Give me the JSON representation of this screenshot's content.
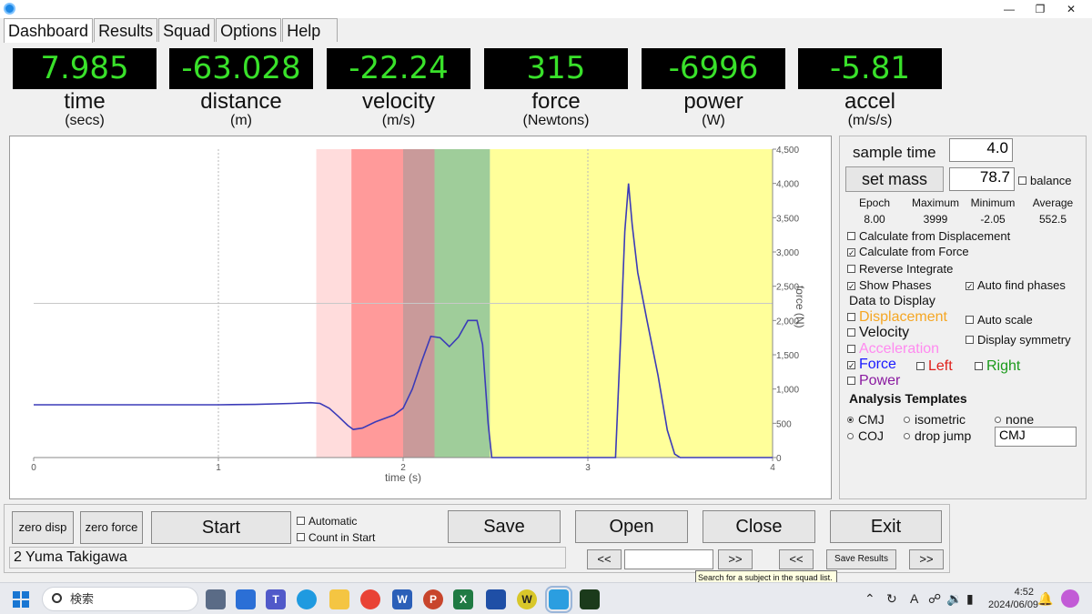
{
  "tabs": [
    {
      "label": "Dashboard",
      "active": true
    },
    {
      "label": "Results",
      "active": false
    },
    {
      "label": "Squad",
      "active": false
    },
    {
      "label": "Options",
      "active": false
    },
    {
      "label": "Help",
      "active": false
    }
  ],
  "metrics": [
    {
      "value": "7.985",
      "name": "time",
      "unit": "(secs)"
    },
    {
      "value": "-63.028",
      "name": "distance",
      "unit": "(m)"
    },
    {
      "value": "-22.24",
      "name": "velocity",
      "unit": "(m/s)"
    },
    {
      "value": "315",
      "name": "force",
      "unit": "(Newtons)"
    },
    {
      "value": "-6996",
      "name": "power",
      "unit": "(W)"
    },
    {
      "value": "-5.81",
      "name": "accel",
      "unit": "(m/s/s)"
    }
  ],
  "colors": {
    "lcd_text": "#39e12a",
    "force_line": "#3b3bb8",
    "phase_pink": "#ffdcdc",
    "phase_red": "#ff9a9a",
    "phase_brown": "#c99a9a",
    "phase_green": "#9fcd9a",
    "phase_yellow": "#ffff9a",
    "displacement": "#f5a623",
    "acceleration": "#ff8af0",
    "force_label": "#1a1aff",
    "left_label": "#e0201a",
    "right_label": "#1a9a1a",
    "power_label": "#8a1aa0"
  },
  "chart": {
    "x_ticks": [
      "0",
      "1",
      "2",
      "3",
      "4"
    ],
    "y_ticks": [
      "0",
      "500",
      "1,000",
      "1,500",
      "2,000",
      "2,500",
      "3,000",
      "3,500",
      "4,000",
      "4,500"
    ],
    "xlabel": "time (s)",
    "ylabel": "force (N)"
  },
  "chart_data": {
    "type": "line",
    "xlim": [
      0,
      4
    ],
    "ylim": [
      0,
      4500
    ],
    "xlabel": "time (s)",
    "ylabel": "force (N)",
    "phases": [
      {
        "start": 1.53,
        "end": 1.72,
        "color": "#ffdcdc"
      },
      {
        "start": 1.72,
        "end": 2.0,
        "color": "#ff9a9a"
      },
      {
        "start": 2.0,
        "end": 2.17,
        "color": "#c99a9a"
      },
      {
        "start": 2.17,
        "end": 2.47,
        "color": "#9fcd9a"
      },
      {
        "start": 2.47,
        "end": 4.0,
        "color": "#ffff9a"
      }
    ],
    "series": [
      {
        "x": [
          0,
          0.5,
          1.0,
          1.2,
          1.4,
          1.5,
          1.55,
          1.6,
          1.65,
          1.7,
          1.73,
          1.78,
          1.85,
          1.95,
          2.0,
          2.05,
          2.1,
          2.15,
          2.2,
          2.25,
          2.3,
          2.35,
          2.4,
          2.43,
          2.46,
          2.48,
          2.5,
          3.0,
          3.15,
          3.18,
          3.2,
          3.22,
          3.24,
          3.27,
          3.32,
          3.38,
          3.43,
          3.47,
          3.5,
          4.0
        ],
        "y": [
          770,
          770,
          770,
          775,
          790,
          800,
          790,
          720,
          600,
          470,
          410,
          430,
          520,
          620,
          720,
          1000,
          1400,
          1770,
          1750,
          1620,
          1760,
          2000,
          2000,
          1650,
          500,
          0,
          0,
          0,
          0,
          1900,
          3300,
          4000,
          3400,
          2700,
          2000,
          1200,
          400,
          50,
          0,
          0
        ]
      }
    ],
    "grid": true
  },
  "right_panel": {
    "sample_time_label": "sample time",
    "sample_time_value": "4.0",
    "set_mass_label": "set mass",
    "mass_value": "78.7",
    "balance_label": "balance",
    "stats_headers": [
      "Epoch",
      "Maximum",
      "Minimum",
      "Average"
    ],
    "stats_values": [
      "8.00",
      "3999",
      "-2.05",
      "552.5"
    ],
    "calc_displacement": "Calculate from Displacement",
    "calc_force": "Calculate from Force",
    "reverse_integrate": "Reverse Integrate",
    "show_phases": "Show Phases",
    "auto_find_phases": "Auto find phases",
    "data_to_display": "Data to Display",
    "displacement": "Displacement",
    "velocity": "Velocity",
    "acceleration": "Acceleration",
    "force": "Force",
    "left": "Left",
    "right": "Right",
    "power": "Power",
    "auto_scale": "Auto scale",
    "display_symmetry": "Display symmetry",
    "analysis_templates": "Analysis Templates",
    "cmj": "CMJ",
    "isometric": "isometric",
    "none": "none",
    "coj": "COJ",
    "drop_jump": "drop jump",
    "template_value": "CMJ"
  },
  "bottom": {
    "zero_disp": "zero disp",
    "zero_force": "zero force",
    "start": "Start",
    "automatic": "Automatic",
    "count_in_start": "Count in Start",
    "save": "Save",
    "open": "Open",
    "close": "Close",
    "exit": "Exit",
    "subject": "2 Yuma Takigawa",
    "prev": "<<",
    "next": ">>",
    "save_results": "Save Results",
    "tooltip": "Search for a subject in the squad list."
  },
  "taskbar": {
    "search_text": "検索",
    "time": "4:52",
    "date": "2024/06/09",
    "ime": "A"
  }
}
